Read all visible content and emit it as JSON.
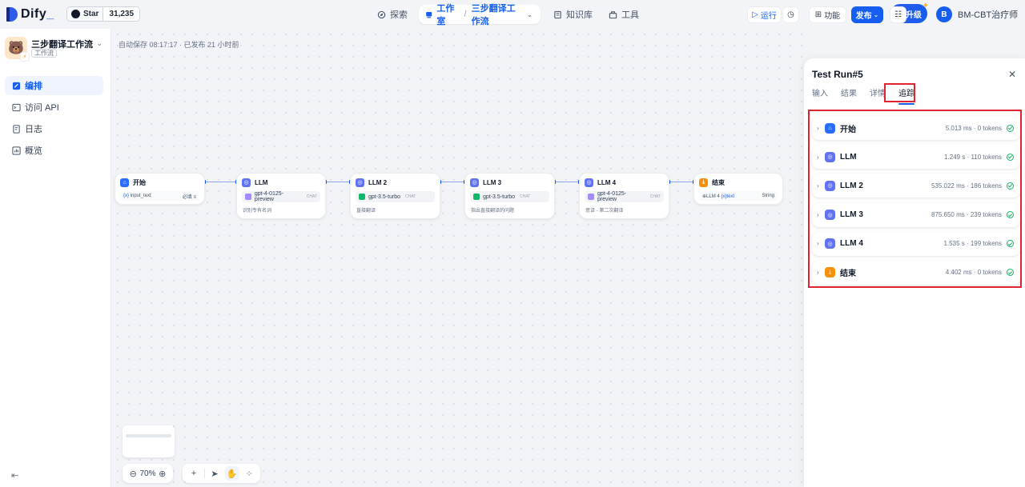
{
  "brand": {
    "name": "Dify",
    "github_label": "Star",
    "github_count": "31,235"
  },
  "topnav": {
    "explore": "探索",
    "studio": "工作室",
    "sep": "/",
    "app": "三步翻译工作流",
    "knowledge": "知识库",
    "tools": "工具"
  },
  "account": {
    "upgrade": "升级",
    "avatar_letter": "B",
    "user_name": "BM-CBT治疗师"
  },
  "sidebar": {
    "app_name": "三步翻译工作流",
    "app_type": "工作流",
    "items": [
      {
        "label": "编排",
        "icon": "orchestrate-icon",
        "active": true
      },
      {
        "label": "访问 API",
        "icon": "terminal-icon",
        "active": false
      },
      {
        "label": "日志",
        "icon": "log-icon",
        "active": false
      },
      {
        "label": "概览",
        "icon": "overview-icon",
        "active": false
      }
    ]
  },
  "canvas": {
    "autosave": "自动保存 08:17:17 · 已发布 21 小时前",
    "run": "运行",
    "features": "功能",
    "publish": "发布",
    "zoom": "70%"
  },
  "nodes": [
    {
      "title": "开始",
      "var": "input_text",
      "var_tag": "必填",
      "var_tag2": "≡"
    },
    {
      "title": "LLM",
      "model": "gpt-4-0125-preview",
      "mode": "CHAT",
      "note": "识别专有名词"
    },
    {
      "title": "LLM 2",
      "model": "gpt-3.5-turbo",
      "mode": "CHAT",
      "note": "直接翻译"
    },
    {
      "title": "LLM 3",
      "model": "gpt-3.5-turbo",
      "mode": "CHAT",
      "note": "指出直接翻译的问题"
    },
    {
      "title": "LLM 4",
      "model": "gpt-4-0125-preview",
      "mode": "CHAT",
      "note": "意译 - 第二次翻译"
    },
    {
      "title": "结束",
      "ref": "LLM 4",
      "ref_var": "text",
      "type": "String"
    }
  ],
  "panel": {
    "title": "Test Run#5",
    "tabs": [
      "输入",
      "结果",
      "详情",
      "追踪"
    ],
    "active_tab": "追踪",
    "trace": [
      {
        "name": "开始",
        "meta": "5.013 ms · 0 tokens",
        "icon": "home-icon",
        "color": "#296dff"
      },
      {
        "name": "LLM",
        "meta": "1.249 s · 110 tokens",
        "icon": "llm-icon",
        "color": "#6172f3"
      },
      {
        "name": "LLM 2",
        "meta": "535.022 ms · 186 tokens",
        "icon": "llm-icon",
        "color": "#6172f3"
      },
      {
        "name": "LLM 3",
        "meta": "875.650 ms · 239 tokens",
        "icon": "llm-icon",
        "color": "#6172f3"
      },
      {
        "name": "LLM 4",
        "meta": "1.535 s · 199 tokens",
        "icon": "llm-icon",
        "color": "#6172f3"
      },
      {
        "name": "结束",
        "meta": "4.402 ms · 0 tokens",
        "icon": "end-icon",
        "color": "#f79009"
      }
    ]
  }
}
